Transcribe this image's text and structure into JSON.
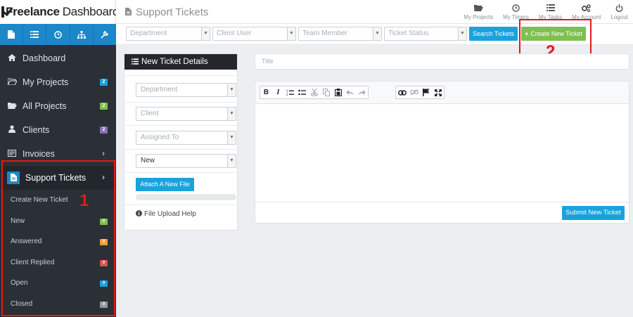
{
  "brand": {
    "bold": "Freelance",
    "rest": "Dashboard"
  },
  "quickbar": [
    "document-icon",
    "list-icon",
    "clock-icon",
    "sitemap-icon",
    "wrench-icon"
  ],
  "nav": {
    "dashboard": "Dashboard",
    "my_projects": {
      "label": "My Projects",
      "count": "2",
      "color": "#1ba2dc"
    },
    "all_projects": {
      "label": "All Projects",
      "count": "2",
      "color": "#7fc04f"
    },
    "clients": {
      "label": "Clients",
      "count": "2",
      "color": "#8a6fb5"
    },
    "invoices": "Invoices",
    "support_tickets": "Support Tickets"
  },
  "subnav": {
    "create": "Create New Ticket",
    "new": {
      "label": "New",
      "count": "0",
      "color": "#7fc04f"
    },
    "answered": {
      "label": "Answered",
      "count": "0",
      "color": "#f0a030"
    },
    "client_replied": {
      "label": "Client Replied",
      "count": "0",
      "color": "#d9534f"
    },
    "open": {
      "label": "Open",
      "count": "0",
      "color": "#1ba2dc"
    },
    "closed": {
      "label": "Closed",
      "count": "0",
      "color": "#999999"
    }
  },
  "annotations": {
    "one": "1",
    "two": "2"
  },
  "header": {
    "page_title": "Support Tickets",
    "links": {
      "my_projects": "My Projects",
      "my_timers": "My Timers",
      "my_tasks": "My Tasks",
      "my_account": "My Account",
      "logout": "Logout"
    }
  },
  "filters": {
    "department": "Department",
    "client_user": "Client User",
    "team_member": "Team Member",
    "ticket_status": "Ticket Status",
    "search_button": "Search Tickets",
    "create_button": "Create New Ticket"
  },
  "form": {
    "panel_title": "New Ticket Details",
    "department": "Department",
    "client": "Client",
    "assigned_to": "Assigned To",
    "status": "New",
    "attach_button": "Attach A New File",
    "upload_progress": 0,
    "upload_help": "File Upload Help",
    "title_placeholder": "Title",
    "submit_button": "Submit New Ticket"
  }
}
